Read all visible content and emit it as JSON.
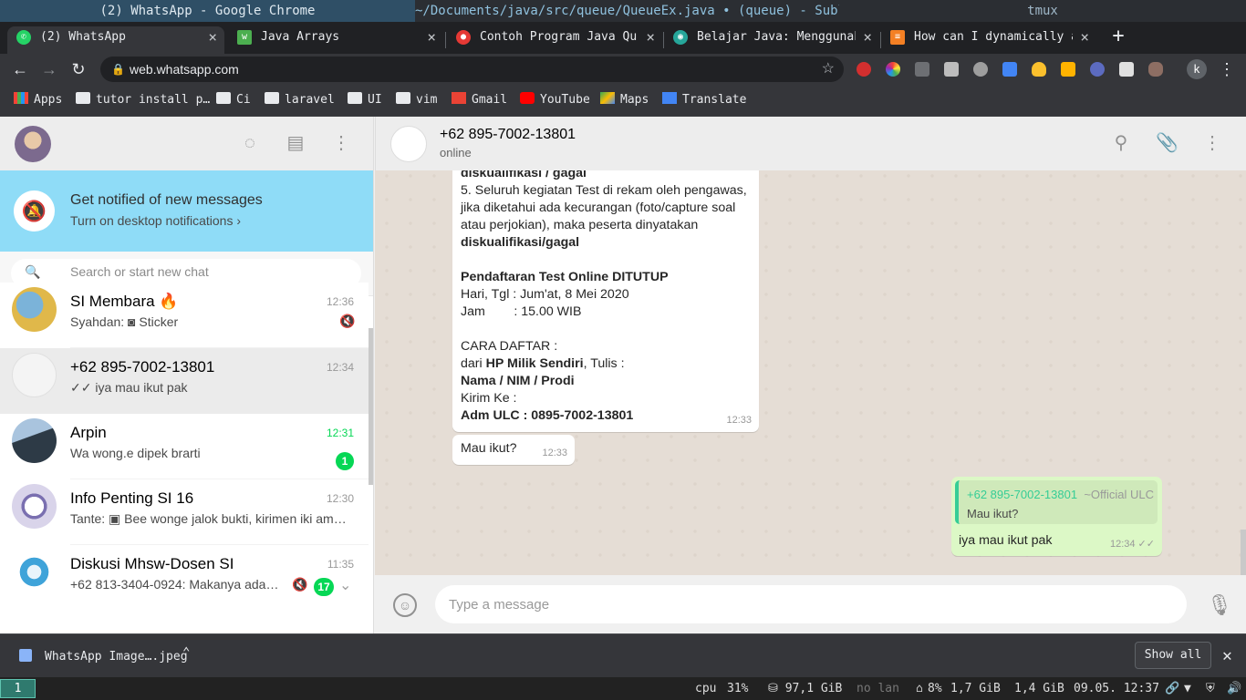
{
  "desktop": {
    "top_bar": {
      "window1": "(2) WhatsApp - Google Chrome",
      "window2": "~/Documents/java/src/queue/QueueEx.java • (queue) - Sublime Tex…",
      "window3": "tmux"
    },
    "status_bar": {
      "workspace": "1",
      "cpu_label": "cpu",
      "cpu_value": "31%",
      "disk": "⛁ 97,1 GiB",
      "lan": "no lan",
      "bat": "8%",
      "mem1": "1,7 GiB",
      "mem2": "1,4 GiB",
      "clock": "09.05. 12:37"
    }
  },
  "browser": {
    "tabs": [
      {
        "label": "(2) WhatsApp",
        "icon": "whatsapp-icon",
        "color": "#25d366",
        "active": true
      },
      {
        "label": "Java Arrays",
        "icon": "w3schools-icon",
        "color": "#4caf50"
      },
      {
        "label": "Contoh Program Java Queue",
        "icon": "site-icon",
        "color": "#e53935"
      },
      {
        "label": "Belajar Java: Menggunakan",
        "icon": "site-icon",
        "color": "#26a69a"
      },
      {
        "label": "How can I dynamically add",
        "icon": "stackoverflow-icon",
        "color": "#f48024"
      }
    ],
    "url": "web.whatsapp.com",
    "profile_initial": "k",
    "bookmarks": [
      {
        "label": "Apps",
        "icon": "apps-grid-icon"
      },
      {
        "label": "tutor install p…",
        "icon": "folder-icon"
      },
      {
        "label": "Ci",
        "icon": "folder-icon"
      },
      {
        "label": "laravel",
        "icon": "folder-icon"
      },
      {
        "label": "UI",
        "icon": "folder-icon"
      },
      {
        "label": "vim",
        "icon": "folder-icon"
      },
      {
        "label": "Gmail",
        "icon": "gmail-icon"
      },
      {
        "label": "YouTube",
        "icon": "youtube-icon"
      },
      {
        "label": "Maps",
        "icon": "maps-icon"
      },
      {
        "label": "Translate",
        "icon": "translate-icon"
      }
    ],
    "download": {
      "filename": "WhatsApp Image….jpeg",
      "show_all": "Show all"
    }
  },
  "whatsapp": {
    "notification": {
      "title": "Get notified of new messages",
      "subtitle": "Turn on desktop notifications ›"
    },
    "search_placeholder": "Search or start new chat",
    "chats": [
      {
        "name": "SI Membara 🔥",
        "time": "12:36",
        "preview": "Syahdan: ◙ Sticker",
        "muted": true,
        "avatar": "#e0b84a"
      },
      {
        "name": "+62 895-7002-13801",
        "time": "12:34",
        "preview": "✓✓ iya mau ikut pak",
        "selected": true,
        "avatar": "#f4f4f4"
      },
      {
        "name": "Arpin",
        "time": "12:31",
        "preview": "Wa wong.e dipek brarti",
        "unread": "1",
        "avatar": "#5f7d9a"
      },
      {
        "name": "Info Penting SI 16",
        "time": "12:30",
        "preview": "Tante: ▣ Bee wonge jalok bukti, kirimen iki am…",
        "avatar": "#d9d4ea"
      },
      {
        "name": "Diskusi Mhsw-Dosen SI",
        "time": "11:35",
        "preview": "+62 813-3404-0924: Makanya ada …",
        "muted": true,
        "unread": "17",
        "avatar": "#3fa3d9"
      }
    ],
    "conversation": {
      "name": "+62 895-7002-13801",
      "status": "online",
      "incoming_lines": [
        {
          "text": "diskualifikasi / gagal",
          "bold": true
        },
        {
          "text": "5. Seluruh kegiatan Test di rekam oleh pengawas,"
        },
        {
          "text": "jika diketahui ada kecurangan (foto/capture soal"
        },
        {
          "text": "atau perjokian), maka peserta dinyatakan"
        },
        {
          "text": "diskualifikasi/gagal",
          "bold": true
        },
        {
          "text": ""
        },
        {
          "text": "Pendaftaran Test Online DITUTUP",
          "bold": true
        },
        {
          "text": "Hari, Tgl : Jum'at, 8 Mei 2020"
        },
        {
          "text": "Jam        : 15.00 WIB"
        },
        {
          "text": ""
        },
        {
          "text": "CARA DAFTAR :"
        },
        {
          "text": "dari ",
          "bold_part": "HP Milik Sendiri",
          "tail": ", Tulis :"
        },
        {
          "text": "Nama / NIM / Prodi",
          "bold": true
        },
        {
          "text": "Kirim Ke :"
        },
        {
          "text": "Adm ULC : 0895-7002-13801",
          "bold": true
        }
      ],
      "incoming_time": "12:33",
      "incoming2_text": "Mau ikut?",
      "incoming2_time": "12:33",
      "quote_name": "+62 895-7002-13801",
      "quote_alias": "~Official ULC",
      "quote_text": "Mau ikut?",
      "reply_text": "iya mau ikut pak",
      "reply_time": "12:34 ✓✓"
    },
    "composer_placeholder": "Type a message"
  }
}
